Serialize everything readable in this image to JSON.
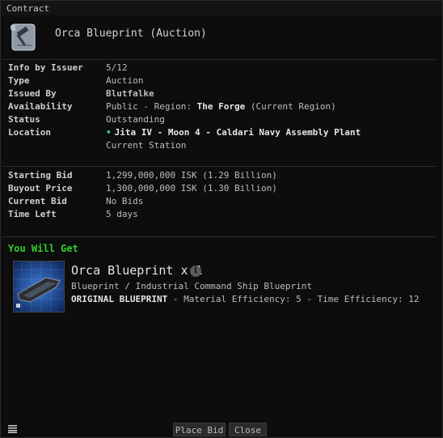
{
  "window": {
    "title": "Contract"
  },
  "header": {
    "name": "Orca Blueprint (Auction)"
  },
  "details": [
    {
      "label": "Info by Issuer",
      "value": "5/12"
    },
    {
      "label": "Type",
      "value": "Auction"
    },
    {
      "label": "Issued By",
      "value": "Blutfalke"
    },
    {
      "label": "Availability",
      "prefix": "Public - Region: ",
      "region": "The Forge",
      "suffix": " (Current Region)"
    },
    {
      "label": "Status",
      "value": "Outstanding"
    },
    {
      "label": "Location",
      "value": "Jita IV - Moon 4 - Caldari Navy Assembly Plant",
      "sub": "Current Station"
    }
  ],
  "bids": [
    {
      "label": "Starting Bid",
      "value": "1,299,000,000 ISK (1.29 Billion)"
    },
    {
      "label": "Buyout Price",
      "value": "1,300,000,000 ISK (1.30 Billion)"
    },
    {
      "label": "Current Bid",
      "value": "No Bids"
    },
    {
      "label": "Time Left",
      "value": "5 days"
    }
  ],
  "you_will_get": {
    "heading": "You Will Get",
    "item_title": "Orca Blueprint x 1",
    "item_type": "Blueprint / Industrial Command Ship Blueprint",
    "original": "ORIGINAL BLUEPRINT",
    "efficiency": " - Material Efficiency: 5 - Time Efficiency: 12"
  },
  "buttons": {
    "place_bid": "Place Bid",
    "close": "Close"
  },
  "icons": {
    "header": "gavel-scroll-icon",
    "info": "info-icon",
    "menu": "menu-icon"
  },
  "colors": {
    "heading_green": "#2fcf2f",
    "location_dot": "#38c48e"
  }
}
